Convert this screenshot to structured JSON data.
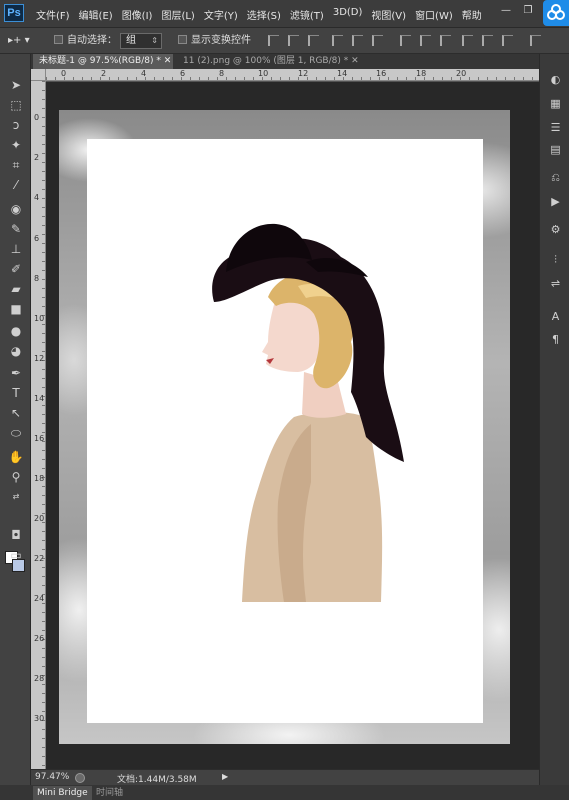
{
  "app": {
    "logo": "Ps"
  },
  "menu": [
    "文件(F)",
    "编辑(E)",
    "图像(I)",
    "图层(L)",
    "文字(Y)",
    "选择(S)",
    "滤镜(T)",
    "3D(D)",
    "视图(V)",
    "窗口(W)",
    "帮助"
  ],
  "options": {
    "auto_select_label": "自动选择：",
    "auto_select_value": "组",
    "show_transform_label": "显示变换控件"
  },
  "tabs": [
    {
      "label": "未标题-1 @ 97.5%(RGB/8) *",
      "active": true
    },
    {
      "label": "11 (2).png @ 100% (图层 1, RGB/8) *",
      "active": false
    }
  ],
  "ruler": {
    "horizontal": [
      "0",
      "2",
      "4",
      "6",
      "8",
      "10",
      "12",
      "14",
      "16",
      "18",
      "20"
    ],
    "vertical": [
      "0",
      "2",
      "4",
      "6",
      "8",
      "10",
      "12",
      "14",
      "16",
      "18",
      "20",
      "22",
      "24",
      "26",
      "28",
      "30"
    ]
  },
  "status": {
    "zoom": "97.47%",
    "doc_info": "文档:1.44M/3.58M"
  },
  "bottom_tabs": [
    "Mini Bridge",
    "时间轴"
  ],
  "colors": {
    "foreground": "#ffffff",
    "background": "#b9c9e6",
    "accent": "#1f8ce8",
    "hat": "#1a0d14"
  },
  "icons": {
    "tools": [
      "move-icon",
      "marquee-icon",
      "lasso-icon",
      "magic-wand-icon",
      "crop-icon",
      "eyedropper-icon",
      "healing-brush-icon",
      "brush-icon",
      "stamp-icon",
      "history-brush-icon",
      "eraser-icon",
      "gradient-icon",
      "blur-icon",
      "dodge-icon",
      "pen-icon",
      "type-icon",
      "path-select-icon",
      "ellipse-icon",
      "hand-icon",
      "zoom-icon"
    ],
    "right_dock": [
      "color-icon",
      "swatches-icon",
      "layers-icon",
      "channels-icon",
      "history-icon",
      "actions-icon",
      "properties-icon",
      "adjustments-icon",
      "character-icon",
      "paragraph-icon"
    ]
  }
}
